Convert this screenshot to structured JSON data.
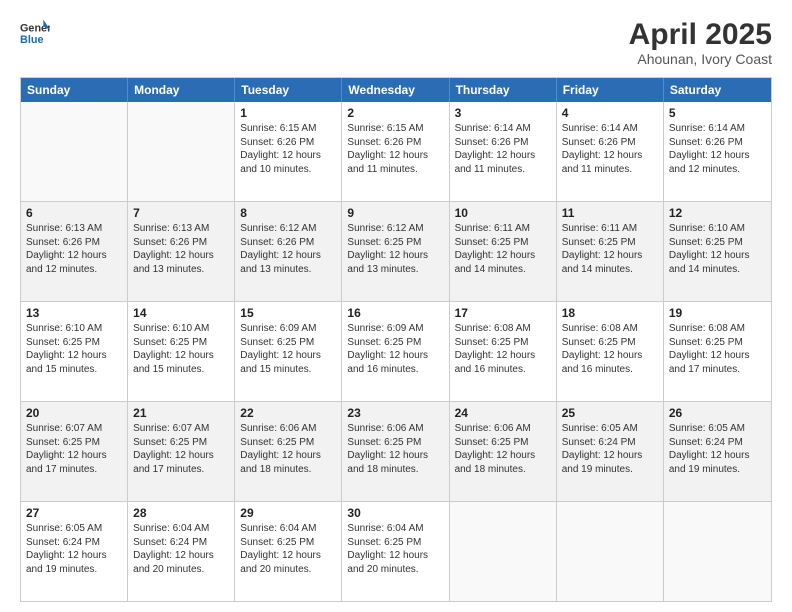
{
  "header": {
    "logo_general": "General",
    "logo_blue": "Blue",
    "month_title": "April 2025",
    "location": "Ahounan, Ivory Coast"
  },
  "weekdays": [
    "Sunday",
    "Monday",
    "Tuesday",
    "Wednesday",
    "Thursday",
    "Friday",
    "Saturday"
  ],
  "weeks": [
    [
      {
        "day": "",
        "info": ""
      },
      {
        "day": "",
        "info": ""
      },
      {
        "day": "1",
        "info": "Sunrise: 6:15 AM\nSunset: 6:26 PM\nDaylight: 12 hours and 10 minutes."
      },
      {
        "day": "2",
        "info": "Sunrise: 6:15 AM\nSunset: 6:26 PM\nDaylight: 12 hours and 11 minutes."
      },
      {
        "day": "3",
        "info": "Sunrise: 6:14 AM\nSunset: 6:26 PM\nDaylight: 12 hours and 11 minutes."
      },
      {
        "day": "4",
        "info": "Sunrise: 6:14 AM\nSunset: 6:26 PM\nDaylight: 12 hours and 11 minutes."
      },
      {
        "day": "5",
        "info": "Sunrise: 6:14 AM\nSunset: 6:26 PM\nDaylight: 12 hours and 12 minutes."
      }
    ],
    [
      {
        "day": "6",
        "info": "Sunrise: 6:13 AM\nSunset: 6:26 PM\nDaylight: 12 hours and 12 minutes."
      },
      {
        "day": "7",
        "info": "Sunrise: 6:13 AM\nSunset: 6:26 PM\nDaylight: 12 hours and 13 minutes."
      },
      {
        "day": "8",
        "info": "Sunrise: 6:12 AM\nSunset: 6:26 PM\nDaylight: 12 hours and 13 minutes."
      },
      {
        "day": "9",
        "info": "Sunrise: 6:12 AM\nSunset: 6:25 PM\nDaylight: 12 hours and 13 minutes."
      },
      {
        "day": "10",
        "info": "Sunrise: 6:11 AM\nSunset: 6:25 PM\nDaylight: 12 hours and 14 minutes."
      },
      {
        "day": "11",
        "info": "Sunrise: 6:11 AM\nSunset: 6:25 PM\nDaylight: 12 hours and 14 minutes."
      },
      {
        "day": "12",
        "info": "Sunrise: 6:10 AM\nSunset: 6:25 PM\nDaylight: 12 hours and 14 minutes."
      }
    ],
    [
      {
        "day": "13",
        "info": "Sunrise: 6:10 AM\nSunset: 6:25 PM\nDaylight: 12 hours and 15 minutes."
      },
      {
        "day": "14",
        "info": "Sunrise: 6:10 AM\nSunset: 6:25 PM\nDaylight: 12 hours and 15 minutes."
      },
      {
        "day": "15",
        "info": "Sunrise: 6:09 AM\nSunset: 6:25 PM\nDaylight: 12 hours and 15 minutes."
      },
      {
        "day": "16",
        "info": "Sunrise: 6:09 AM\nSunset: 6:25 PM\nDaylight: 12 hours and 16 minutes."
      },
      {
        "day": "17",
        "info": "Sunrise: 6:08 AM\nSunset: 6:25 PM\nDaylight: 12 hours and 16 minutes."
      },
      {
        "day": "18",
        "info": "Sunrise: 6:08 AM\nSunset: 6:25 PM\nDaylight: 12 hours and 16 minutes."
      },
      {
        "day": "19",
        "info": "Sunrise: 6:08 AM\nSunset: 6:25 PM\nDaylight: 12 hours and 17 minutes."
      }
    ],
    [
      {
        "day": "20",
        "info": "Sunrise: 6:07 AM\nSunset: 6:25 PM\nDaylight: 12 hours and 17 minutes."
      },
      {
        "day": "21",
        "info": "Sunrise: 6:07 AM\nSunset: 6:25 PM\nDaylight: 12 hours and 17 minutes."
      },
      {
        "day": "22",
        "info": "Sunrise: 6:06 AM\nSunset: 6:25 PM\nDaylight: 12 hours and 18 minutes."
      },
      {
        "day": "23",
        "info": "Sunrise: 6:06 AM\nSunset: 6:25 PM\nDaylight: 12 hours and 18 minutes."
      },
      {
        "day": "24",
        "info": "Sunrise: 6:06 AM\nSunset: 6:25 PM\nDaylight: 12 hours and 18 minutes."
      },
      {
        "day": "25",
        "info": "Sunrise: 6:05 AM\nSunset: 6:24 PM\nDaylight: 12 hours and 19 minutes."
      },
      {
        "day": "26",
        "info": "Sunrise: 6:05 AM\nSunset: 6:24 PM\nDaylight: 12 hours and 19 minutes."
      }
    ],
    [
      {
        "day": "27",
        "info": "Sunrise: 6:05 AM\nSunset: 6:24 PM\nDaylight: 12 hours and 19 minutes."
      },
      {
        "day": "28",
        "info": "Sunrise: 6:04 AM\nSunset: 6:24 PM\nDaylight: 12 hours and 20 minutes."
      },
      {
        "day": "29",
        "info": "Sunrise: 6:04 AM\nSunset: 6:25 PM\nDaylight: 12 hours and 20 minutes."
      },
      {
        "day": "30",
        "info": "Sunrise: 6:04 AM\nSunset: 6:25 PM\nDaylight: 12 hours and 20 minutes."
      },
      {
        "day": "",
        "info": ""
      },
      {
        "day": "",
        "info": ""
      },
      {
        "day": "",
        "info": ""
      }
    ]
  ]
}
